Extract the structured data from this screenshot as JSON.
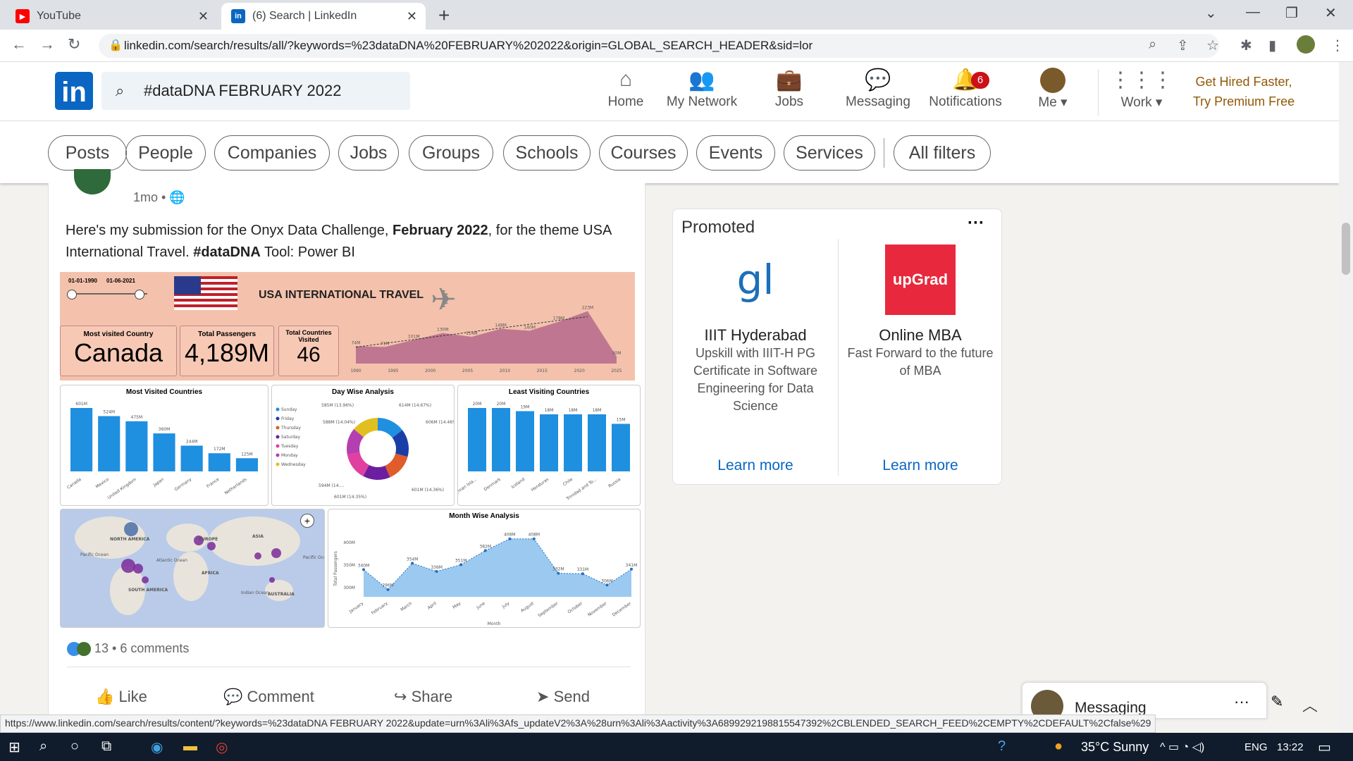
{
  "browser": {
    "tabs": [
      {
        "title": "YouTube",
        "favicon": "youtube-icon"
      },
      {
        "title": "(6) Search | LinkedIn",
        "favicon": "linkedin-icon"
      }
    ],
    "url": "linkedin.com/search/results/all/?keywords=%23dataDNA%20FEBRUARY%202022&origin=GLOBAL_SEARCH_HEADER&sid=lor",
    "status_url": "https://www.linkedin.com/search/results/content/?keywords=%23dataDNA FEBRUARY 2022&update=urn%3Ali%3Afs_updateV2%3A%28urn%3Ali%3Aactivity%3A6899292198815547392%2CBLENDED_SEARCH_FEED%2CEMPTY%2CDEFAULT%2Cfalse%29"
  },
  "header": {
    "logo": "in",
    "search_value": "#dataDNA FEBRUARY 2022",
    "nav": [
      {
        "label": "Home",
        "icon": "home-icon"
      },
      {
        "label": "My Network",
        "icon": "network-icon"
      },
      {
        "label": "Jobs",
        "icon": "briefcase-icon"
      },
      {
        "label": "Messaging",
        "icon": "chat-icon"
      },
      {
        "label": "Notifications",
        "icon": "bell-icon",
        "badge": "6"
      },
      {
        "label": "Me",
        "icon": "avatar"
      },
      {
        "label": "Work",
        "icon": "grid-icon"
      }
    ],
    "premium": {
      "line1": "Get Hired Faster,",
      "line2": "Try Premium Free"
    }
  },
  "filters": [
    "Posts",
    "People",
    "Companies",
    "Jobs",
    "Groups",
    "Schools",
    "Courses",
    "Events",
    "Services",
    "All filters"
  ],
  "post": {
    "time": "1mo •",
    "text_parts": [
      "Here's my submission for the Onyx Data Challenge, ",
      "February 2022",
      ", for the theme USA International Travel. ",
      "#dataDNA",
      " Tool: Power BI"
    ],
    "reactions": "13",
    "comments": "6 comments",
    "actions": [
      "Like",
      "Comment",
      "Share",
      "Send"
    ]
  },
  "dashboard": {
    "date_start": "01-01-1990",
    "date_end": "01-06-2021",
    "title": "USA INTERNATIONAL TRAVEL",
    "kpis": [
      {
        "label": "Most visited Country",
        "value": "Canada"
      },
      {
        "label": "Total Passengers",
        "value": "4,189M"
      },
      {
        "label": "Total Countries Visited",
        "value": "46"
      }
    ],
    "map_labels": [
      "NORTH AMERICA",
      "EUROPE",
      "ASIA",
      "AFRICA",
      "SOUTH AMERICA",
      "AUSTRALIA",
      "Pacific Ocean",
      "Atlantic Ocean",
      "Indian Ocean",
      "Pacific Ocean"
    ]
  },
  "chart_data": [
    {
      "type": "area",
      "title": "",
      "x": [
        1990,
        1995,
        2000,
        2005,
        2010,
        2015,
        2020,
        2025
      ],
      "labels": [
        "74M",
        "71M",
        "101M",
        "130M",
        "114M",
        "148M",
        "140M",
        "178M",
        "223M",
        "30M"
      ],
      "values": [
        74,
        71,
        101,
        130,
        114,
        148,
        140,
        178,
        223,
        30
      ]
    },
    {
      "type": "bar",
      "title": "Most Visited Countries",
      "categories": [
        "Canada",
        "Mexico",
        "United Kingdom",
        "Japan",
        "Germany",
        "France",
        "Netherlands"
      ],
      "values": [
        601,
        524,
        475,
        360,
        244,
        172,
        125
      ],
      "labels": [
        "601M",
        "524M",
        "475M",
        "360M",
        "244M",
        "172M",
        "125M"
      ]
    },
    {
      "type": "pie",
      "title": "Day Wise Analysis",
      "categories": [
        "Sunday",
        "Friday",
        "Thursday",
        "Saturday",
        "Tuesday",
        "Monday",
        "Wednesday"
      ],
      "values": [
        614,
        606,
        601,
        601,
        594,
        588,
        585
      ],
      "labels": [
        "585M (13.96%)",
        "614M (14.67%)",
        "588M (14.04%)",
        "606M (14.46%)",
        "601M (14.36%)",
        "601M (14.35%)",
        "594M (14...."
      ],
      "colors": [
        "#1f8fe0",
        "#1a3ea8",
        "#e05c2a",
        "#6b1fa0",
        "#e040a0",
        "#b43fb0",
        "#e0c020"
      ]
    },
    {
      "type": "bar",
      "title": "Least Visiting Countries",
      "categories": [
        "Cayman Isla...",
        "Denmark",
        "Iceland",
        "Honduras",
        "Chile",
        "Trinidad and To...",
        "Russia"
      ],
      "values": [
        20,
        20,
        19,
        18,
        18,
        18,
        15
      ],
      "labels": [
        "20M",
        "20M",
        "19M",
        "18M",
        "18M",
        "18M",
        "15M"
      ]
    },
    {
      "type": "area",
      "title": "Month Wise Analysis",
      "xlabel": "Month",
      "ylabel": "Total Passengers",
      "categories": [
        "January",
        "February",
        "March",
        "April",
        "May",
        "June",
        "July",
        "August",
        "September",
        "October",
        "November",
        "December"
      ],
      "values": [
        340,
        296,
        354,
        336,
        351,
        382,
        408,
        408,
        332,
        331,
        306,
        341
      ],
      "labels": [
        "340M",
        "296M",
        "354M",
        "336M",
        "351M",
        "382M",
        "408M",
        "408M",
        "332M",
        "331M",
        "306M",
        "341M"
      ],
      "yticks": [
        "300M",
        "350M",
        "400M"
      ]
    }
  ],
  "promoted": {
    "title": "Promoted",
    "ads": [
      {
        "logo": "gl",
        "name": "IIIT Hyderabad",
        "desc": "Upskill with IIIT-H PG Certificate in Software Engineering for Data Science",
        "cta": "Learn more"
      },
      {
        "logo": "upGrad",
        "name": "Online MBA",
        "desc": "Fast Forward to the future of MBA",
        "cta": "Learn more"
      }
    ]
  },
  "messaging": {
    "label": "Messaging"
  },
  "taskbar": {
    "weather": "35°C  Sunny",
    "lang": "ENG",
    "time": "13:22"
  },
  "colors": {
    "linkedin_blue": "#0a66c2",
    "premium": "#915907",
    "dashboard_bg": "#f7c9b5",
    "bar": "#1f8fe0"
  }
}
